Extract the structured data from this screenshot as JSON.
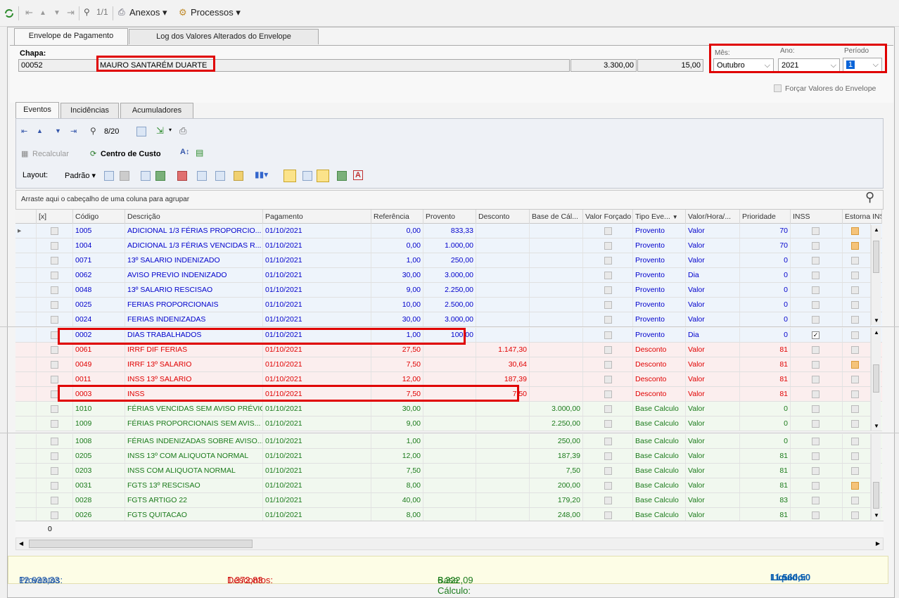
{
  "toolbar": {
    "counter": "1/1",
    "anexos_label": "Anexos",
    "processos_label": "Processos"
  },
  "tabs": [
    {
      "label": "Envelope de Pagamento"
    },
    {
      "label": "Log dos Valores Alterados do Envelope"
    }
  ],
  "header": {
    "chapa_label": "Chapa:",
    "chapa_value": "00052",
    "nome_value": "MAURO SANTARÉM DUARTE",
    "valor1": "3.300,00",
    "valor2": "15,00",
    "mes_label": "Mês:",
    "mes_value": "Outubro",
    "ano_label": "Ano:",
    "ano_value": "2021",
    "periodo_label": "Período",
    "periodo_value": "1",
    "forcar_label": "Forçar Valores do Envelope"
  },
  "subtabs": [
    {
      "label": "Eventos"
    },
    {
      "label": "Incidências"
    },
    {
      "label": "Acumuladores"
    }
  ],
  "gridtoolbar": {
    "counter": "8/20",
    "recalcular_label": "Recalcular",
    "centro_label": "Centro de Custo",
    "layout_label": "Layout:",
    "padrao_label": "Padrão"
  },
  "group_hint": "Arraste aqui o cabeçalho de uma coluna para agrupar",
  "columns": [
    "[x]",
    "Código",
    "Descrição",
    "Pagamento",
    "Referência",
    "Provento",
    "Desconto",
    "Base de Cál...",
    "Valor Forçado",
    "Tipo Eve...",
    "Valor/Hora/...",
    "Prioridade",
    "INSS",
    "Estorna INSS"
  ],
  "rows": [
    {
      "codigo": "1005",
      "descricao": "ADICIONAL 1/3 FÉRIAS PROPORCIO...",
      "pagamento": "01/10/2021",
      "referencia": "0,00",
      "provento": "833,33",
      "desconto": "",
      "base": "",
      "tipo": "Provento",
      "valor_hora": "Valor",
      "prioridade": "70",
      "inss": "",
      "estorna": "orange",
      "kind": "blue"
    },
    {
      "codigo": "1004",
      "descricao": "ADICIONAL 1/3 FÉRIAS VENCIDAS R...",
      "pagamento": "01/10/2021",
      "referencia": "0,00",
      "provento": "1.000,00",
      "desconto": "",
      "base": "",
      "tipo": "Provento",
      "valor_hora": "Valor",
      "prioridade": "70",
      "inss": "",
      "estorna": "orange",
      "kind": "blue"
    },
    {
      "codigo": "0071",
      "descricao": "13º SALARIO INDENIZADO",
      "pagamento": "01/10/2021",
      "referencia": "1,00",
      "provento": "250,00",
      "desconto": "",
      "base": "",
      "tipo": "Provento",
      "valor_hora": "Valor",
      "prioridade": "0",
      "inss": "",
      "estorna": "",
      "kind": "blue"
    },
    {
      "codigo": "0062",
      "descricao": "AVISO PREVIO INDENIZADO",
      "pagamento": "01/10/2021",
      "referencia": "30,00",
      "provento": "3.000,00",
      "desconto": "",
      "base": "",
      "tipo": "Provento",
      "valor_hora": "Dia",
      "prioridade": "0",
      "inss": "",
      "estorna": "",
      "kind": "blue"
    },
    {
      "codigo": "0048",
      "descricao": "13º SALARIO RESCISAO",
      "pagamento": "01/10/2021",
      "referencia": "9,00",
      "provento": "2.250,00",
      "desconto": "",
      "base": "",
      "tipo": "Provento",
      "valor_hora": "Valor",
      "prioridade": "0",
      "inss": "",
      "estorna": "",
      "kind": "blue"
    },
    {
      "codigo": "0025",
      "descricao": "FERIAS PROPORCIONAIS",
      "pagamento": "01/10/2021",
      "referencia": "10,00",
      "provento": "2.500,00",
      "desconto": "",
      "base": "",
      "tipo": "Provento",
      "valor_hora": "Valor",
      "prioridade": "0",
      "inss": "",
      "estorna": "",
      "kind": "blue"
    },
    {
      "codigo": "0024",
      "descricao": "FERIAS INDENIZADAS",
      "pagamento": "01/10/2021",
      "referencia": "30,00",
      "provento": "3.000,00",
      "desconto": "",
      "base": "",
      "tipo": "Provento",
      "valor_hora": "Valor",
      "prioridade": "0",
      "inss": "",
      "estorna": "",
      "kind": "blue"
    },
    {
      "codigo": "0002",
      "descricao": "DIAS TRABALHADOS",
      "pagamento": "01/10/2021",
      "referencia": "1,00",
      "provento": "100,00",
      "desconto": "",
      "base": "",
      "tipo": "Provento",
      "valor_hora": "Dia",
      "prioridade": "0",
      "inss": "checked",
      "estorna": "",
      "kind": "blue"
    },
    {
      "codigo": "0061",
      "descricao": "IRRF DIF FERIAS",
      "pagamento": "01/10/2021",
      "referencia": "27,50",
      "provento": "",
      "desconto": "1.147,30",
      "base": "",
      "tipo": "Desconto",
      "valor_hora": "Valor",
      "prioridade": "81",
      "inss": "",
      "estorna": "",
      "kind": "red"
    },
    {
      "codigo": "0049",
      "descricao": "IRRF 13º SALARIO",
      "pagamento": "01/10/2021",
      "referencia": "7,50",
      "provento": "",
      "desconto": "30,64",
      "base": "",
      "tipo": "Desconto",
      "valor_hora": "Valor",
      "prioridade": "81",
      "inss": "",
      "estorna": "orange",
      "kind": "red"
    },
    {
      "codigo": "0011",
      "descricao": "INSS 13º SALARIO",
      "pagamento": "01/10/2021",
      "referencia": "12,00",
      "provento": "",
      "desconto": "187,39",
      "base": "",
      "tipo": "Desconto",
      "valor_hora": "Valor",
      "prioridade": "81",
      "inss": "",
      "estorna": "",
      "kind": "red"
    },
    {
      "codigo": "0003",
      "descricao": "INSS",
      "pagamento": "01/10/2021",
      "referencia": "7,50",
      "provento": "",
      "desconto": "7,50",
      "base": "",
      "tipo": "Desconto",
      "valor_hora": "Valor",
      "prioridade": "81",
      "inss": "",
      "estorna": "",
      "kind": "red"
    },
    {
      "codigo": "1010",
      "descricao": "FÉRIAS VENCIDAS SEM AVISO PRÉVIO",
      "pagamento": "01/10/2021",
      "referencia": "30,00",
      "provento": "",
      "desconto": "",
      "base": "3.000,00",
      "tipo": "Base Calculo",
      "valor_hora": "Valor",
      "prioridade": "0",
      "inss": "",
      "estorna": "",
      "kind": "green"
    },
    {
      "codigo": "1009",
      "descricao": "FÉRIAS PROPORCIONAIS SEM AVIS...",
      "pagamento": "01/10/2021",
      "referencia": "9,00",
      "provento": "",
      "desconto": "",
      "base": "2.250,00",
      "tipo": "Base Calculo",
      "valor_hora": "Valor",
      "prioridade": "0",
      "inss": "",
      "estorna": "",
      "kind": "green"
    },
    {
      "codigo": "1008",
      "descricao": "FÉRIAS INDENIZADAS SOBRE AVISO...",
      "pagamento": "01/10/2021",
      "referencia": "1,00",
      "provento": "",
      "desconto": "",
      "base": "250,00",
      "tipo": "Base Calculo",
      "valor_hora": "Valor",
      "prioridade": "0",
      "inss": "",
      "estorna": "",
      "kind": "green"
    },
    {
      "codigo": "0205",
      "descricao": "INSS 13º COM ALIQUOTA NORMAL",
      "pagamento": "01/10/2021",
      "referencia": "12,00",
      "provento": "",
      "desconto": "",
      "base": "187,39",
      "tipo": "Base Calculo",
      "valor_hora": "Valor",
      "prioridade": "81",
      "inss": "",
      "estorna": "",
      "kind": "green"
    },
    {
      "codigo": "0203",
      "descricao": "INSS COM ALIQUOTA NORMAL",
      "pagamento": "01/10/2021",
      "referencia": "7,50",
      "provento": "",
      "desconto": "",
      "base": "7,50",
      "tipo": "Base Calculo",
      "valor_hora": "Valor",
      "prioridade": "81",
      "inss": "",
      "estorna": "",
      "kind": "green"
    },
    {
      "codigo": "0031",
      "descricao": "FGTS 13º RESCISAO",
      "pagamento": "01/10/2021",
      "referencia": "8,00",
      "provento": "",
      "desconto": "",
      "base": "200,00",
      "tipo": "Base Calculo",
      "valor_hora": "Valor",
      "prioridade": "81",
      "inss": "",
      "estorna": "orange",
      "kind": "green"
    },
    {
      "codigo": "0028",
      "descricao": "FGTS ARTIGO 22",
      "pagamento": "01/10/2021",
      "referencia": "40,00",
      "provento": "",
      "desconto": "",
      "base": "179,20",
      "tipo": "Base Calculo",
      "valor_hora": "Valor",
      "prioridade": "83",
      "inss": "",
      "estorna": "",
      "kind": "green"
    },
    {
      "codigo": "0026",
      "descricao": "FGTS QUITACAO",
      "pagamento": "01/10/2021",
      "referencia": "8,00",
      "provento": "",
      "desconto": "",
      "base": "248,00",
      "tipo": "Base Calculo",
      "valor_hora": "Valor",
      "prioridade": "81",
      "inss": "",
      "estorna": "",
      "kind": "green"
    }
  ],
  "grid_footer_count": "0",
  "totals": {
    "proventos_label": "Proventos:",
    "proventos_value": "12.933,33",
    "descontos_label": "Descontos:",
    "descontos_value": "1.372,83",
    "base_label": "Base Cálculo:",
    "base_value": "6.322,09",
    "liquido_label": "Líquido:",
    "liquido_value": "11.560,50"
  },
  "colors": {
    "blue_text": "#0000cc",
    "red_text": "#e00000",
    "green_text": "#1a7a1a",
    "highlight": "#e00000",
    "liquido": "#0b5fb0"
  }
}
